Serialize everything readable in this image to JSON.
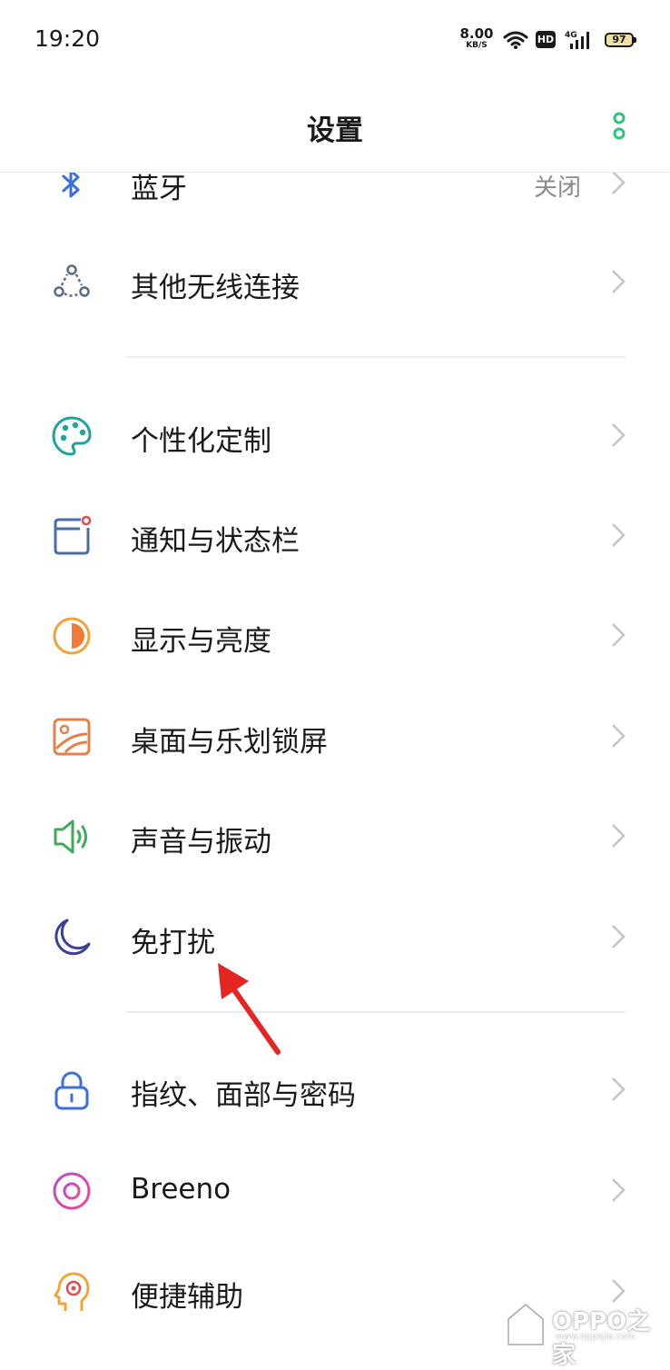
{
  "status_bar": {
    "time": "19:20",
    "net_speed_value": "8.00",
    "net_speed_unit": "KB/S",
    "hd_badge": "HD",
    "network_type": "4G",
    "battery": "97"
  },
  "header": {
    "title": "设置"
  },
  "settings": {
    "items": [
      {
        "label": "蓝牙",
        "value": "关闭",
        "icon": "bluetooth-icon"
      },
      {
        "label": "其他无线连接",
        "icon": "wireless-connections-icon"
      },
      {
        "label": "个性化定制",
        "icon": "palette-icon"
      },
      {
        "label": "通知与状态栏",
        "icon": "notification-icon"
      },
      {
        "label": "显示与亮度",
        "icon": "brightness-icon"
      },
      {
        "label": "桌面与乐划锁屏",
        "icon": "wallpaper-icon"
      },
      {
        "label": "声音与振动",
        "icon": "speaker-icon"
      },
      {
        "label": "免打扰",
        "icon": "moon-icon"
      },
      {
        "label": "指纹、面部与密码",
        "icon": "lock-icon"
      },
      {
        "label": "Breeno",
        "icon": "breeno-icon"
      },
      {
        "label": "便捷辅助",
        "icon": "assist-head-icon"
      }
    ]
  },
  "colors": {
    "accent": "#2ec27e",
    "annotation_arrow": "#e52521"
  },
  "watermark": {
    "text": "OPPO之家",
    "url": "www.oppojia.com"
  }
}
